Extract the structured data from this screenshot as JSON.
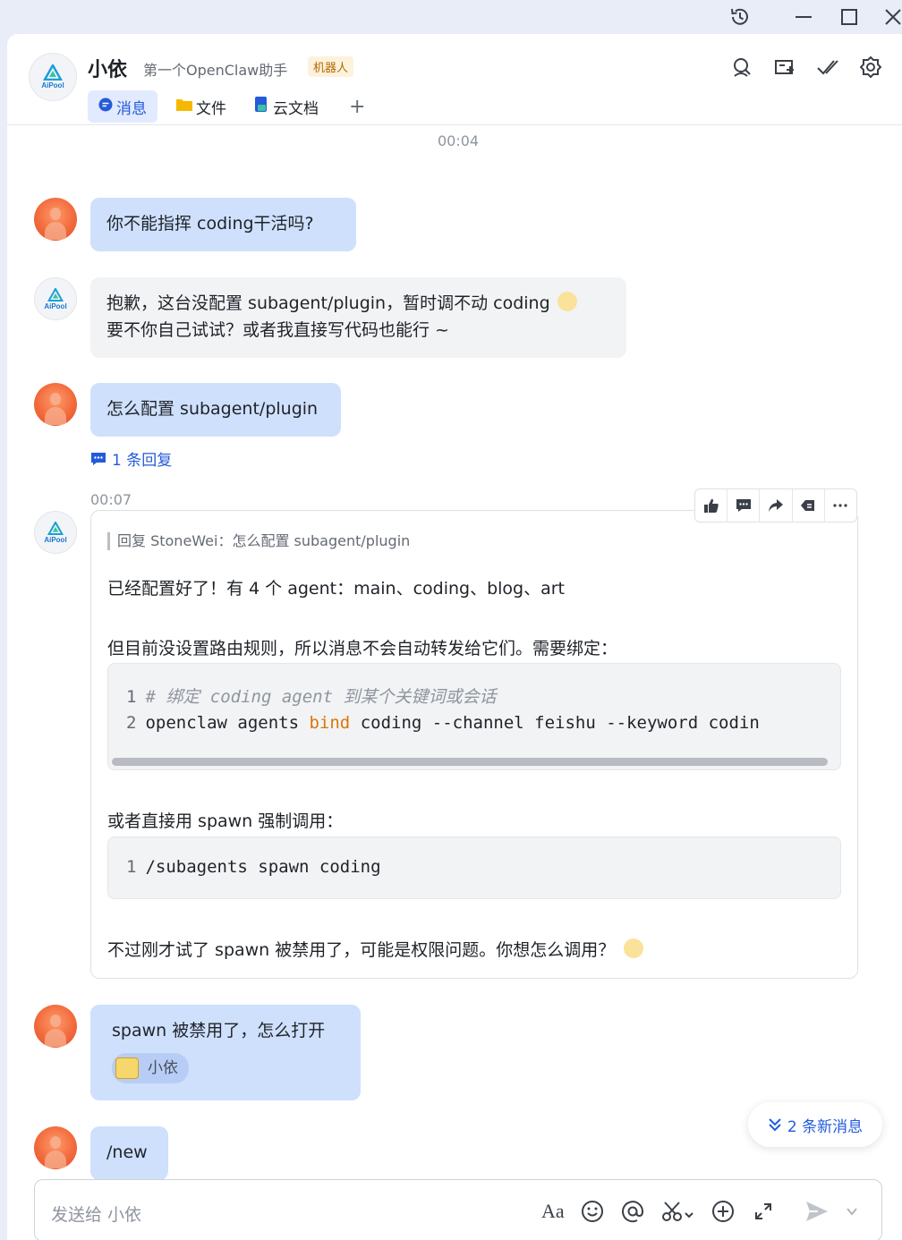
{
  "chat": {
    "name": "小依",
    "description": "第一个OpenClaw助手",
    "badge": "机器人",
    "avatar_text": "AiPool"
  },
  "tabs": [
    {
      "label": "消息",
      "active": true
    },
    {
      "label": "文件",
      "active": false
    },
    {
      "label": "云文档",
      "active": false
    },
    {
      "label": "+",
      "active": false
    }
  ],
  "messages": {
    "time1": "00:04",
    "m1": "你不能指挥 coding干活吗?",
    "m2_line1": "抱歉，这台没配置 subagent/plugin，暂时调不动 coding",
    "m2_line2": "要不你自己试试？或者我直接写代码也能行 ~",
    "m3": "怎么配置 subagent/plugin",
    "reply_count": "1 条回复",
    "time2": "00:07",
    "card": {
      "quote": "回复 StoneWei：怎么配置 subagent/plugin",
      "p1": "已经配置好了！有 4 个 agent：main、coding、blog、art",
      "p2": "但目前没设置路由规则，所以消息不会自动转发给它们。需要绑定：",
      "code1_l1_num": "1",
      "code1_l1": "# 绑定 coding agent 到某个关键词或会话",
      "code1_l2_num": "2",
      "code1_l2_a": "openclaw agents ",
      "code1_l2_kw": "bind",
      "code1_l2_b": " coding --channel feishu --keyword codin",
      "p3": "或者直接用 spawn 强制调用：",
      "code2_l1_num": "1",
      "code2_l1": "/subagents spawn coding",
      "p4": "不过刚才试了 spawn 被禁用了，可能是权限问题。你想怎么调用？"
    },
    "m4": "spawn 被禁用了，怎么打开",
    "m4_mention": "小依",
    "m5": "/new"
  },
  "new_messages": "2 条新消息",
  "composer": {
    "placeholder": "发送给 小依"
  },
  "icons": {
    "history": "history-icon",
    "minimize": "minimize-icon",
    "maximize": "maximize-icon",
    "close": "close-icon",
    "search": "search-icon",
    "add_tab": "add-tab-icon",
    "check": "check-icon",
    "settings": "gear-icon"
  },
  "colors": {
    "accent": "#245bdb",
    "my_bubble": "#cfe0fd",
    "bot_bubble": "#f2f3f5"
  }
}
